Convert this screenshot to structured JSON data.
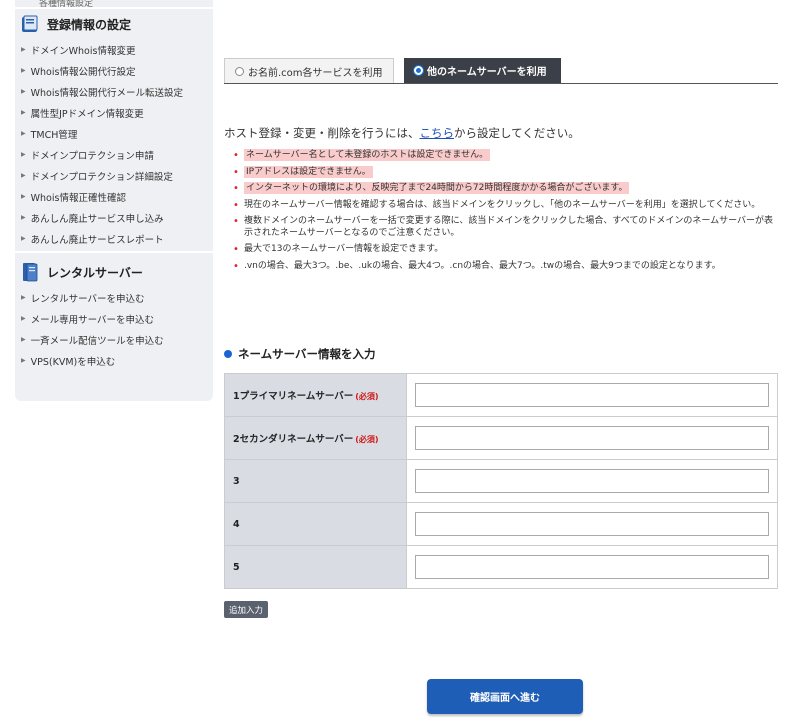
{
  "sidebar": {
    "cutoff_text": "各種情報設定",
    "section1": {
      "title": "登録情報の設定",
      "items": [
        "ドメインWhois情報変更",
        "Whois情報公開代行設定",
        "Whois情報公開代行メール転送設定",
        "属性型JPドメイン情報変更",
        "TMCH管理",
        "ドメインプロテクション申請",
        "ドメインプロテクション詳細設定",
        "Whois情報正確性確認",
        "あんしん廃止サービス申し込み",
        "あんしん廃止サービスレポート"
      ]
    },
    "section2": {
      "title": "レンタルサーバー",
      "items": [
        "レンタルサーバーを申込む",
        "メール専用サーバーを申込む",
        "一斉メール配信ツールを申込む",
        "VPS(KVM)を申込む"
      ]
    }
  },
  "tabs": {
    "tab1": "お名前.com各サービスを利用",
    "tab2": "他のネームサーバーを利用"
  },
  "intro": {
    "before": "ホスト登録・変更・削除を行うには、",
    "link": "こちら",
    "after": "から設定してください。"
  },
  "notes": [
    "ネームサーバー名として未登録のホストは設定できません。",
    "IPアドレスは設定できません。",
    "インターネットの環境により、反映完了まで24時間から72時間程度かかる場合がございます。",
    "現在のネームサーバー情報を確認する場合は、該当ドメインをクリックし、「他のネームサーバーを利用」を選択してください。",
    "複数ドメインのネームサーバーを一括で変更する際に、該当ドメインをクリックした場合、すべてのドメインのネームサーバーが表示されたネームサーバーとなるのでご注意ください。",
    "最大で13のネームサーバー情報を設定できます。",
    ".vnの場合、最大3つ。.be、.ukの場合、最大4つ。.cnの場合、最大7つ。.twの場合、最大9つまでの設定となります。"
  ],
  "section_title": "ネームサーバー情報を入力",
  "ns_rows": {
    "r1": "1プライマリネームサーバー",
    "r2": "2セカンダリネームサーバー",
    "r3": "3",
    "r4": "4",
    "r5": "5",
    "required": "(必須)"
  },
  "add_button": "追加入力",
  "confirm_button": "確認画面へ進む",
  "colors": {
    "accent": "#1e5eb6",
    "highlight": "#f9cbcb",
    "tab_active": "#3b3f47"
  }
}
